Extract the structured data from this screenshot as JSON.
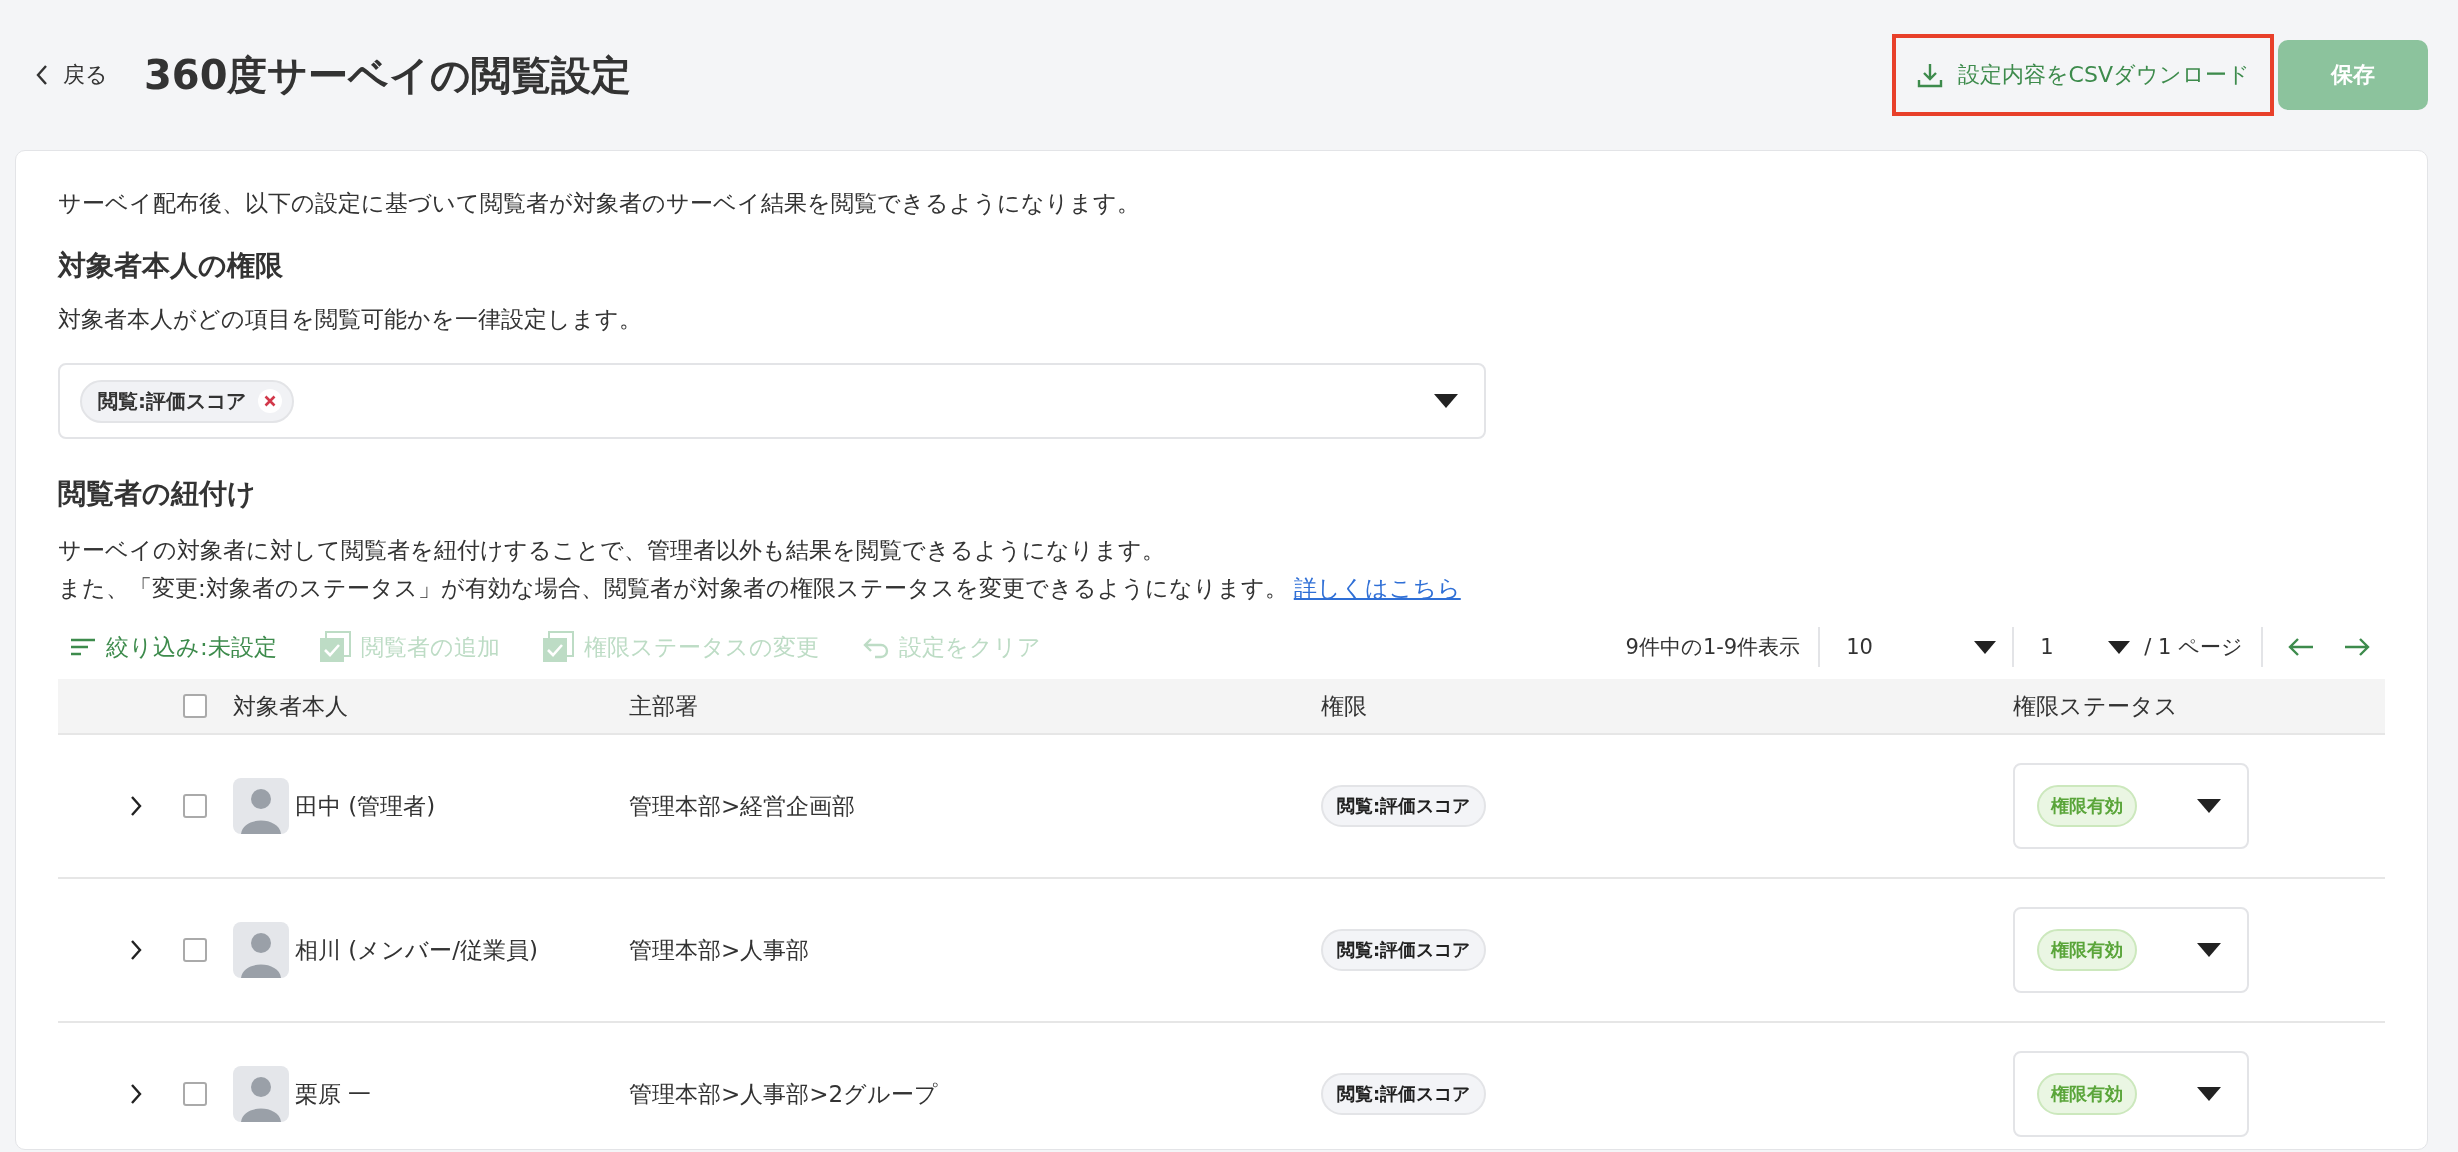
{
  "header": {
    "back": "戻る",
    "title": "360度サーベイの閲覧設定",
    "csv_button": {
      "label": "設定内容をCSVダウンロード",
      "highlighted": true
    },
    "save_button": {
      "label": "保存",
      "disabled": true
    }
  },
  "intro": "サーベイ配布後、以下の設定に基づいて閲覧者が対象者のサーベイ結果を閲覧できるようになります。",
  "self_section": {
    "heading": "対象者本人の権限",
    "description": "対象者本人がどの項目を閲覧可能かを一律設定します。",
    "chips": [
      "閲覧:評価スコア"
    ]
  },
  "viewer_section": {
    "heading": "閲覧者の紐付け",
    "description": "サーベイの対象者に対して閲覧者を紐付けすることで、管理者以外も結果を閲覧できるようになります。",
    "description_2": "また、「変更:対象者のステータス」が有効な場合、閲覧者が対象者の権限ステータスを変更できるようになります。",
    "link": "詳しくはこちら"
  },
  "toolbar": {
    "actions": [
      {
        "kind": "filter",
        "label": "絞り込み:未設定",
        "disabled": false
      },
      {
        "kind": "check",
        "label": "閲覧者の追加",
        "disabled": true
      },
      {
        "kind": "check",
        "label": "権限ステータスの変更",
        "disabled": true
      },
      {
        "kind": "clear",
        "label": "設定をクリア",
        "disabled": true
      }
    ],
    "count": "9件中の1-9件表示",
    "per_page": "10",
    "page": "1",
    "page_total": "/ 1 ページ"
  },
  "table": {
    "select_all_checked": false,
    "columns": [
      "対象者本人",
      "主部署",
      "権限",
      "権限ステータス"
    ],
    "rows": [
      {
        "name": "田中 (管理者)",
        "department": "管理本部>経営企画部",
        "permission": "閲覧:評価スコア",
        "status": "権限有効",
        "checked": false,
        "expanded": false
      },
      {
        "name": "相川 (メンバー/従業員)",
        "department": "管理本部>人事部",
        "permission": "閲覧:評価スコア",
        "status": "権限有効",
        "checked": false,
        "expanded": false
      },
      {
        "name": "栗原 一",
        "department": "管理本部>人事部>2グループ",
        "permission": "閲覧:評価スコア",
        "status": "権限有効",
        "checked": false,
        "expanded": false
      }
    ]
  }
}
